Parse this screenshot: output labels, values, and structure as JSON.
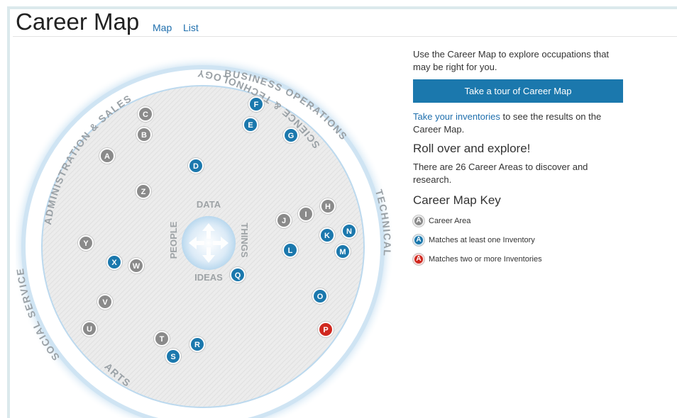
{
  "header": {
    "title": "Career Map",
    "nav_map": "Map",
    "nav_list": "List"
  },
  "map": {
    "ring_labels": {
      "administration_sales": "ADMINISTRATION & SALES",
      "business_operations": "BUSINESS OPERATIONS",
      "technical": "TECHNICAL",
      "science_technology": "SCIENCE & TECHNOLOGY",
      "arts": "ARTS",
      "social_service": "SOCIAL SERVICE"
    },
    "axis_labels": {
      "data": "DATA",
      "things": "THINGS",
      "ideas": "IDEAS",
      "people": "PEOPLE"
    },
    "colors": {
      "gray": "#8a8a8a",
      "blue": "#1b78ad",
      "red": "#d0281f"
    },
    "markers": [
      {
        "letter": "C",
        "status": "gray"
      },
      {
        "letter": "B",
        "status": "gray"
      },
      {
        "letter": "A",
        "status": "gray"
      },
      {
        "letter": "Z",
        "status": "gray"
      },
      {
        "letter": "D",
        "status": "blue"
      },
      {
        "letter": "F",
        "status": "blue"
      },
      {
        "letter": "E",
        "status": "blue"
      },
      {
        "letter": "G",
        "status": "blue"
      },
      {
        "letter": "H",
        "status": "gray"
      },
      {
        "letter": "I",
        "status": "gray"
      },
      {
        "letter": "J",
        "status": "gray"
      },
      {
        "letter": "K",
        "status": "blue"
      },
      {
        "letter": "N",
        "status": "blue"
      },
      {
        "letter": "M",
        "status": "blue"
      },
      {
        "letter": "L",
        "status": "blue"
      },
      {
        "letter": "Q",
        "status": "blue"
      },
      {
        "letter": "O",
        "status": "blue"
      },
      {
        "letter": "P",
        "status": "red"
      },
      {
        "letter": "Y",
        "status": "gray"
      },
      {
        "letter": "X",
        "status": "blue"
      },
      {
        "letter": "W",
        "status": "gray"
      },
      {
        "letter": "V",
        "status": "gray"
      },
      {
        "letter": "U",
        "status": "gray"
      },
      {
        "letter": "T",
        "status": "gray"
      },
      {
        "letter": "R",
        "status": "blue"
      },
      {
        "letter": "S",
        "status": "blue"
      }
    ]
  },
  "panel": {
    "intro": "Use the Career Map to explore occupations that may be right for you.",
    "tour_button": "Take a tour of Career Map",
    "inventories_link": "Take your inventories",
    "inventories_rest": " to see the results on the Career Map.",
    "rollover_heading": "Roll over and explore!",
    "career_areas_text": "There are 26 Career Areas to discover and research.",
    "key_title": "Career Map Key",
    "key": [
      {
        "letter": "A",
        "status": "gray",
        "label": "Career Area"
      },
      {
        "letter": "A",
        "status": "blue",
        "label": "Matches at least one Inventory"
      },
      {
        "letter": "A",
        "status": "red",
        "label": "Matches two or more Inventories"
      }
    ]
  }
}
